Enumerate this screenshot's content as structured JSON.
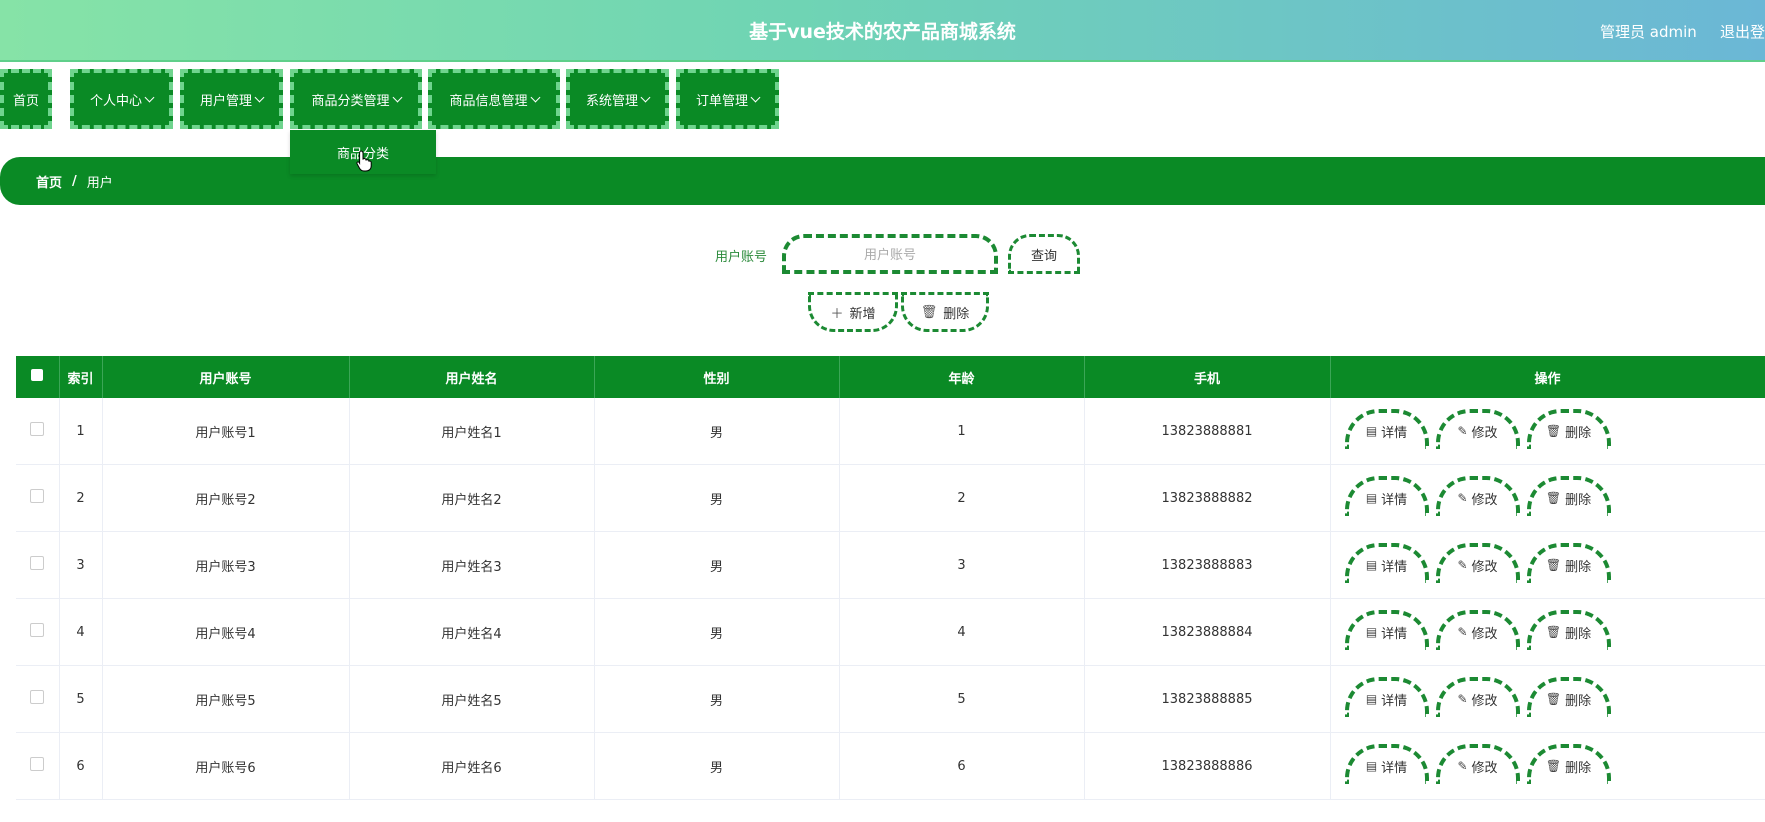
{
  "header": {
    "title": "基于vue技术的农产品商城系统",
    "user": "管理员 admin",
    "logout": "退出登录"
  },
  "nav": {
    "items": [
      {
        "label": "首页",
        "has_menu": false
      },
      {
        "label": "个人中心",
        "has_menu": true
      },
      {
        "label": "用户管理",
        "has_menu": true
      },
      {
        "label": "商品分类管理",
        "has_menu": true
      },
      {
        "label": "商品信息管理",
        "has_menu": true
      },
      {
        "label": "系统管理",
        "has_menu": true
      },
      {
        "label": "订单管理",
        "has_menu": true
      }
    ],
    "open_menu_item": "商品分类"
  },
  "breadcrumb": {
    "home": "首页",
    "separator": "/",
    "current": "用户"
  },
  "search": {
    "label": "用户账号",
    "placeholder": "用户账号",
    "value": "",
    "query_button": "查询"
  },
  "actions": {
    "add": "新增",
    "delete": "删除"
  },
  "table": {
    "columns": [
      "",
      "索引",
      "用户账号",
      "用户姓名",
      "性别",
      "年龄",
      "手机",
      "操作"
    ],
    "rows": [
      {
        "index": "1",
        "account": "用户账号1",
        "name": "用户姓名1",
        "gender": "男",
        "age": "1",
        "phone": "13823888881"
      },
      {
        "index": "2",
        "account": "用户账号2",
        "name": "用户姓名2",
        "gender": "男",
        "age": "2",
        "phone": "13823888882"
      },
      {
        "index": "3",
        "account": "用户账号3",
        "name": "用户姓名3",
        "gender": "男",
        "age": "3",
        "phone": "13823888883"
      },
      {
        "index": "4",
        "account": "用户账号4",
        "name": "用户姓名4",
        "gender": "男",
        "age": "4",
        "phone": "13823888884"
      },
      {
        "index": "5",
        "account": "用户账号5",
        "name": "用户姓名5",
        "gender": "男",
        "age": "5",
        "phone": "13823888885"
      },
      {
        "index": "6",
        "account": "用户账号6",
        "name": "用户姓名6",
        "gender": "男",
        "age": "6",
        "phone": "13823888886"
      }
    ],
    "row_actions": {
      "detail": "详情",
      "edit": "修改",
      "delete": "删除"
    }
  },
  "colors": {
    "primary": "#0a8a25",
    "dashed_border": "#1c8a33",
    "header_start": "#86e3a7",
    "header_end": "#6bb7d6"
  }
}
